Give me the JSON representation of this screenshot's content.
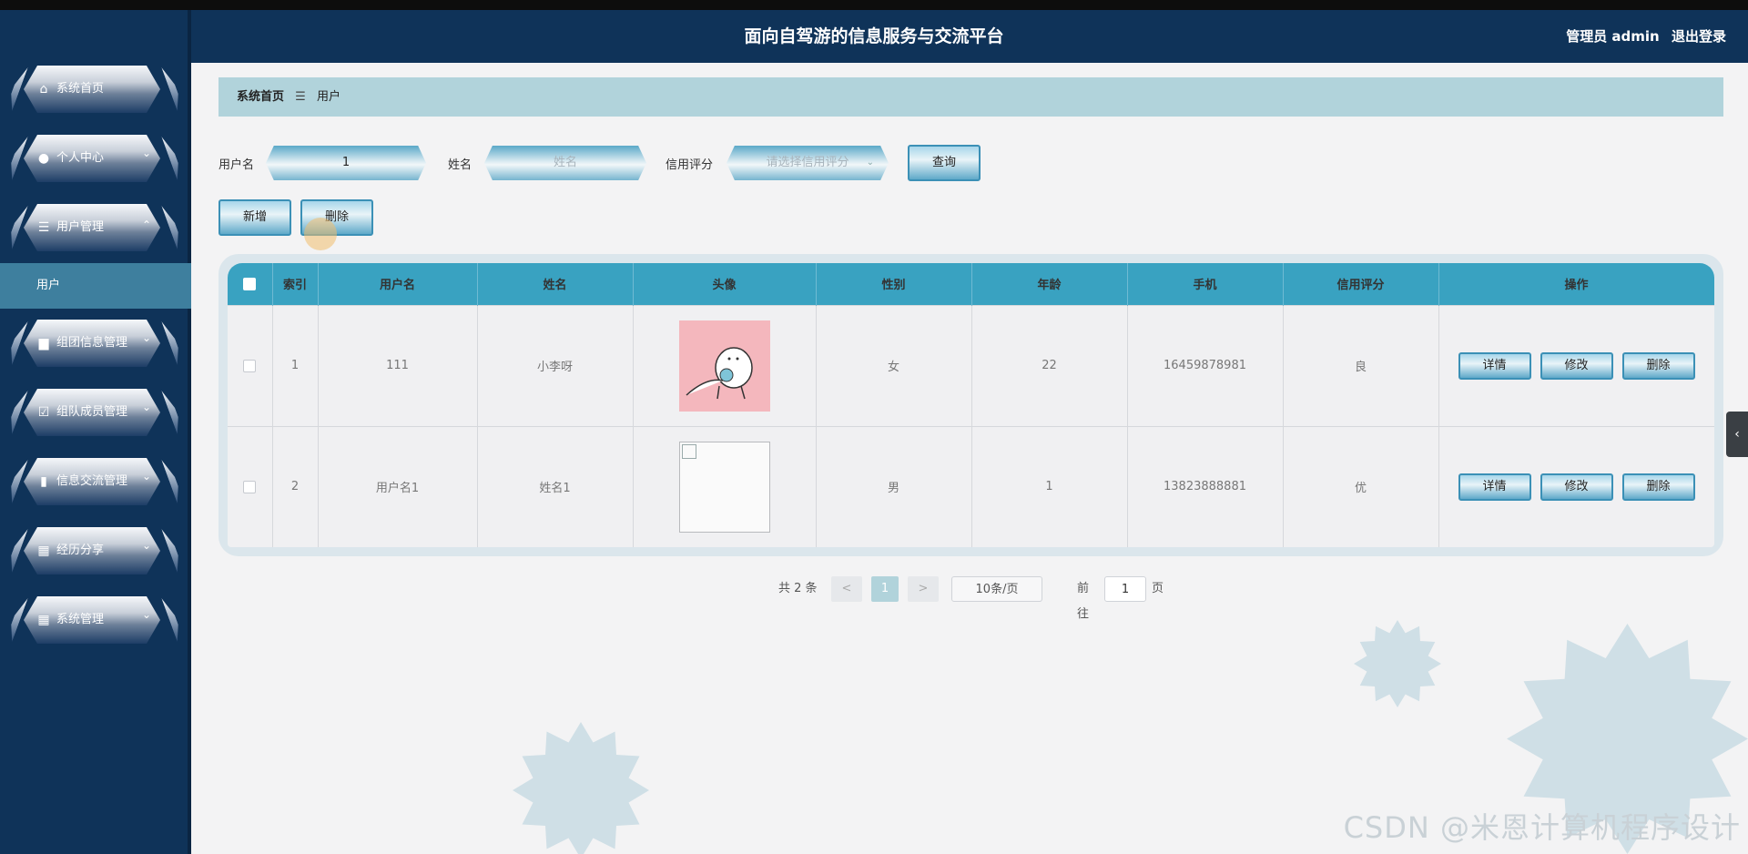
{
  "header": {
    "title": "面向自驾游的信息服务与交流平台",
    "user_label": "管理员 admin",
    "logout": "退出登录"
  },
  "sidebar": {
    "items": [
      {
        "label": "系统首页",
        "icon": "home-icon",
        "has_children": false
      },
      {
        "label": "个人中心",
        "icon": "user-icon",
        "has_children": true
      },
      {
        "label": "用户管理",
        "icon": "list-icon",
        "has_children": true,
        "expanded": true
      },
      {
        "label": "组团信息管理",
        "icon": "printer-icon",
        "has_children": true
      },
      {
        "label": "组队成员管理",
        "icon": "clipboard-icon",
        "has_children": true
      },
      {
        "label": "信息交流管理",
        "icon": "bar-chart-icon",
        "has_children": true
      },
      {
        "label": "经历分享",
        "icon": "grid-icon",
        "has_children": true
      },
      {
        "label": "系统管理",
        "icon": "grid-icon",
        "has_children": true
      }
    ],
    "active_sub": "用户"
  },
  "breadcrumb": {
    "home": "系统首页",
    "sep": "☰",
    "current": "用户"
  },
  "search": {
    "username_label": "用户名",
    "username_value": "1",
    "name_label": "姓名",
    "name_placeholder": "姓名",
    "credit_label": "信用评分",
    "credit_placeholder": "请选择信用评分",
    "query": "查询"
  },
  "actions": {
    "add": "新增",
    "delete": "删除"
  },
  "table": {
    "columns": [
      "索引",
      "用户名",
      "姓名",
      "头像",
      "性别",
      "年龄",
      "手机",
      "信用评分",
      "操作"
    ],
    "rows": [
      {
        "index": "1",
        "username": "111",
        "name": "小李呀",
        "gender": "女",
        "age": "22",
        "phone": "16459878981",
        "credit": "良"
      },
      {
        "index": "2",
        "username": "用户名1",
        "name": "姓名1",
        "gender": "男",
        "age": "1",
        "phone": "13823888881",
        "credit": "优"
      }
    ],
    "row_actions": {
      "detail": "详情",
      "edit": "修改",
      "delete": "删除"
    }
  },
  "pager": {
    "total": "共 2 条",
    "prev": "<",
    "current": "1",
    "next": ">",
    "size": "10条/页",
    "goto": "前往",
    "goto_value": "1",
    "page_unit": "页"
  },
  "watermark": "CSDN @米恩计算机程序设计",
  "colors": {
    "header_bg": "#0f3359",
    "accent": "#39a2c1",
    "breadcrumb_bg": "#b1d3db"
  }
}
